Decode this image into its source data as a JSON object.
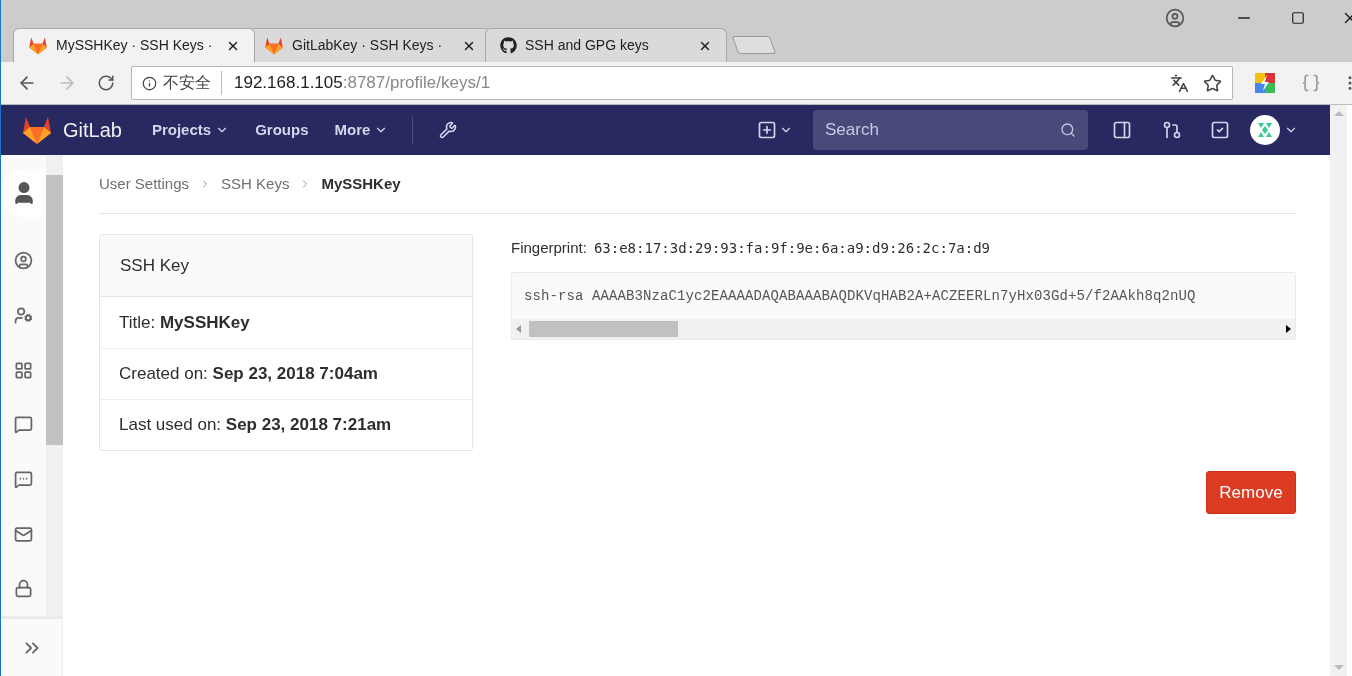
{
  "browser": {
    "tabs": [
      {
        "title": "MySSHKey · SSH Keys ·",
        "selected": true,
        "kind": "gitlab"
      },
      {
        "title": "GitLabKey · SSH Keys ·",
        "selected": false,
        "kind": "gitlab"
      },
      {
        "title": "SSH and GPG keys",
        "selected": false,
        "kind": "github"
      }
    ],
    "address": {
      "security": "不安全",
      "host": "192.168.1.105",
      "path": ":8787/profile/keys/1"
    }
  },
  "navbar": {
    "brand": "GitLab",
    "links": [
      {
        "label": "Projects",
        "dropdown": true
      },
      {
        "label": "Groups",
        "dropdown": false
      },
      {
        "label": "More",
        "dropdown": true
      }
    ],
    "search": {
      "placeholder": "Search"
    }
  },
  "sidebar": {
    "items": [
      {
        "kind": "profile",
        "selected": true
      },
      {
        "kind": "account",
        "selected": false
      },
      {
        "kind": "user-settings",
        "selected": false
      },
      {
        "kind": "applications",
        "selected": false
      },
      {
        "kind": "chat",
        "selected": false
      },
      {
        "kind": "messages",
        "selected": false
      },
      {
        "kind": "mail",
        "selected": false
      },
      {
        "kind": "lock",
        "selected": false
      }
    ]
  },
  "breadcrumbs": [
    "User Settings",
    "SSH Keys",
    "MySSHKey"
  ],
  "key_card": {
    "title": "SSH Key",
    "rows": [
      "Title: **MySSHKey**",
      "Created on: **Sep 23, 2018 7:04am**",
      "Last used on: **Sep 23, 2018 7:21am**"
    ]
  },
  "fingerprint": {
    "label": "Fingerprint:",
    "value": "63:e8:17:3d:29:93:fa:9f:9e:6a:a9:d9:26:2c:7a:d9"
  },
  "public_key": "ssh-rsa AAAAB3NzaC1yc2EAAAADAQABAAABAQDKVqHAB2A+ACZEERLn7yHx03Gd+5/f2AAkh8q2nUQ",
  "remove_button": "Remove"
}
